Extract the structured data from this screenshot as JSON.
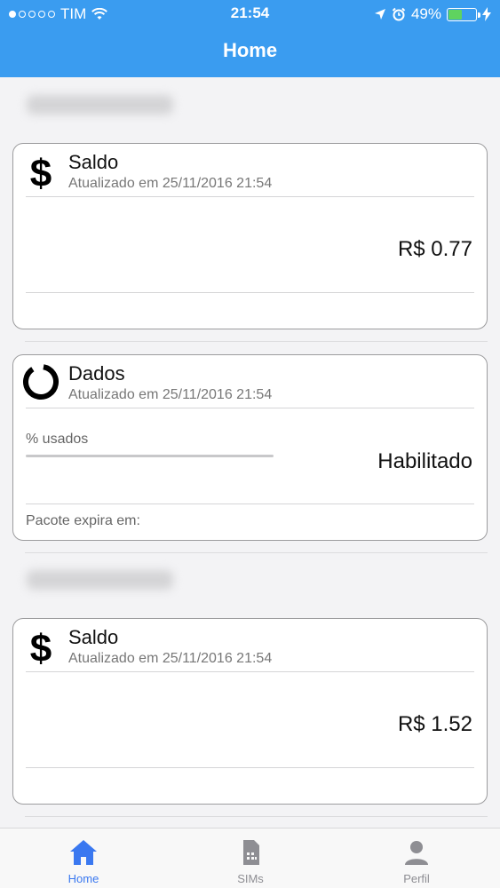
{
  "status_bar": {
    "carrier": "TIM",
    "time": "21:54",
    "battery_percent": "49%",
    "battery_level": 0.49
  },
  "nav": {
    "title": "Home"
  },
  "accounts": [
    {
      "cards": [
        {
          "type": "saldo",
          "title": "Saldo",
          "updated": "Atualizado em 25/11/2016 21:54",
          "value": "R$ 0.77"
        },
        {
          "type": "dados",
          "title": "Dados",
          "updated": "Atualizado em 25/11/2016 21:54",
          "used_label": "% usados",
          "status": "Habilitado",
          "expiry_label": "Pacote expira em:"
        }
      ]
    },
    {
      "cards": [
        {
          "type": "saldo",
          "title": "Saldo",
          "updated": "Atualizado em 25/11/2016 21:54",
          "value": "R$ 1.52"
        }
      ]
    }
  ],
  "tabbar": {
    "tabs": [
      {
        "label": "Home",
        "icon": "home-icon",
        "active": true
      },
      {
        "label": "SIMs",
        "icon": "sim-card-icon",
        "active": false
      },
      {
        "label": "Perfil",
        "icon": "person-icon",
        "active": false
      }
    ],
    "active_color": "#3a78f0",
    "inactive_color": "#8e8e93"
  },
  "colors": {
    "header": "#3a9cf0",
    "card_border": "#9c9c9e",
    "background": "#f3f3f5"
  }
}
